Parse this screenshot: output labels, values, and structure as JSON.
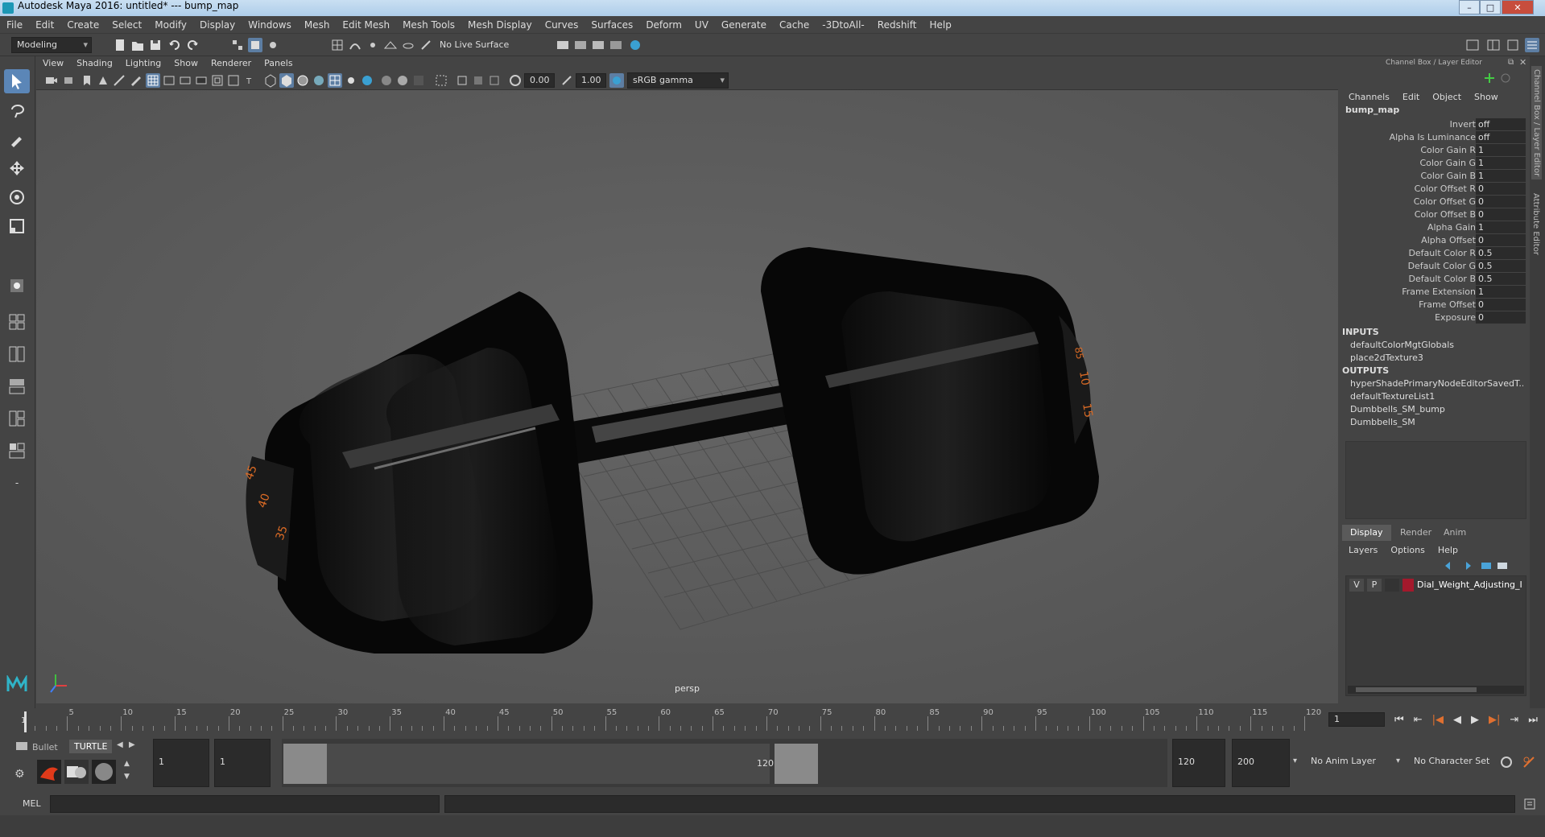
{
  "window": {
    "title": "Autodesk Maya 2016: untitled*   ---   bump_map",
    "minimize": "–",
    "maximize": "□",
    "close": "✕"
  },
  "menubar": [
    "File",
    "Edit",
    "Create",
    "Select",
    "Modify",
    "Display",
    "Windows",
    "Mesh",
    "Edit Mesh",
    "Mesh Tools",
    "Mesh Display",
    "Curves",
    "Surfaces",
    "Deform",
    "UV",
    "Generate",
    "Cache",
    "-3DtoAll-",
    "Redshift",
    "Help"
  ],
  "statusline": {
    "mode": "Modeling",
    "live_surface": "No Live Surface"
  },
  "viewport": {
    "menus": [
      "View",
      "Shading",
      "Lighting",
      "Show",
      "Renderer",
      "Panels"
    ],
    "exposure": "0.00",
    "gamma": "1.00",
    "color_space": "sRGB gamma",
    "camera_label": "persp"
  },
  "channel_box": {
    "header": "Channel Box / Layer Editor",
    "menus": [
      "Channels",
      "Edit",
      "Object",
      "Show"
    ],
    "node_name": "bump_map",
    "attributes": [
      {
        "name": "Invert",
        "value": "off"
      },
      {
        "name": "Alpha Is Luminance",
        "value": "off"
      },
      {
        "name": "Color Gain R",
        "value": "1"
      },
      {
        "name": "Color Gain G",
        "value": "1"
      },
      {
        "name": "Color Gain B",
        "value": "1"
      },
      {
        "name": "Color Offset R",
        "value": "0"
      },
      {
        "name": "Color Offset G",
        "value": "0"
      },
      {
        "name": "Color Offset B",
        "value": "0"
      },
      {
        "name": "Alpha Gain",
        "value": "1"
      },
      {
        "name": "Alpha Offset",
        "value": "0"
      },
      {
        "name": "Default Color R",
        "value": "0.5"
      },
      {
        "name": "Default Color G",
        "value": "0.5"
      },
      {
        "name": "Default Color B",
        "value": "0.5"
      },
      {
        "name": "Frame Extension",
        "value": "1"
      },
      {
        "name": "Frame Offset",
        "value": "0"
      },
      {
        "name": "Exposure",
        "value": "0"
      }
    ],
    "inputs_label": "INPUTS",
    "inputs": [
      "defaultColorMgtGlobals",
      "place2dTexture3"
    ],
    "outputs_label": "OUTPUTS",
    "outputs": [
      "hyperShadePrimaryNodeEditorSavedT...",
      "defaultTextureList1",
      "Dumbbells_SM_bump",
      "Dumbbells_SM"
    ]
  },
  "layer_editor": {
    "tabs": [
      "Display",
      "Render",
      "Anim"
    ],
    "menus": [
      "Layers",
      "Options",
      "Help"
    ],
    "layer": {
      "v": "V",
      "p": "P",
      "name": "Dial_Weight_Adjusting_I",
      "color": "#a3192c"
    }
  },
  "side_tabs": [
    "Channel Box / Layer Editor",
    "Attribute Editor"
  ],
  "timeline": {
    "ticks": [
      "5",
      "10",
      "15",
      "20",
      "25",
      "30",
      "35",
      "40",
      "45",
      "50",
      "55",
      "60",
      "65",
      "70",
      "75",
      "80",
      "85",
      "90",
      "95",
      "100",
      "105",
      "110",
      "115",
      "120"
    ],
    "start_marker": "1",
    "current_frame": "1"
  },
  "range": {
    "shelf_tabs": [
      "Bullet",
      "TURTLE"
    ],
    "start": "1",
    "playback_start": "1",
    "range_start_label": "1",
    "range_end_label": "120",
    "playback_end": "120",
    "end": "200",
    "anim_layer": "No Anim Layer",
    "character_set": "No Character Set"
  },
  "command_line": {
    "language": "MEL"
  }
}
